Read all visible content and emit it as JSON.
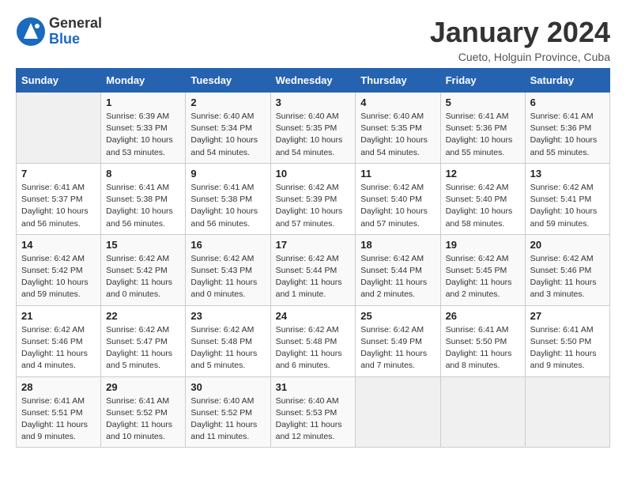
{
  "header": {
    "logo_line1": "General",
    "logo_line2": "Blue",
    "month": "January 2024",
    "location": "Cueto, Holguin Province, Cuba"
  },
  "weekdays": [
    "Sunday",
    "Monday",
    "Tuesday",
    "Wednesday",
    "Thursday",
    "Friday",
    "Saturday"
  ],
  "weeks": [
    [
      {
        "day": "",
        "info": ""
      },
      {
        "day": "1",
        "info": "Sunrise: 6:39 AM\nSunset: 5:33 PM\nDaylight: 10 hours\nand 53 minutes."
      },
      {
        "day": "2",
        "info": "Sunrise: 6:40 AM\nSunset: 5:34 PM\nDaylight: 10 hours\nand 54 minutes."
      },
      {
        "day": "3",
        "info": "Sunrise: 6:40 AM\nSunset: 5:35 PM\nDaylight: 10 hours\nand 54 minutes."
      },
      {
        "day": "4",
        "info": "Sunrise: 6:40 AM\nSunset: 5:35 PM\nDaylight: 10 hours\nand 54 minutes."
      },
      {
        "day": "5",
        "info": "Sunrise: 6:41 AM\nSunset: 5:36 PM\nDaylight: 10 hours\nand 55 minutes."
      },
      {
        "day": "6",
        "info": "Sunrise: 6:41 AM\nSunset: 5:36 PM\nDaylight: 10 hours\nand 55 minutes."
      }
    ],
    [
      {
        "day": "7",
        "info": "Sunrise: 6:41 AM\nSunset: 5:37 PM\nDaylight: 10 hours\nand 56 minutes."
      },
      {
        "day": "8",
        "info": "Sunrise: 6:41 AM\nSunset: 5:38 PM\nDaylight: 10 hours\nand 56 minutes."
      },
      {
        "day": "9",
        "info": "Sunrise: 6:41 AM\nSunset: 5:38 PM\nDaylight: 10 hours\nand 56 minutes."
      },
      {
        "day": "10",
        "info": "Sunrise: 6:42 AM\nSunset: 5:39 PM\nDaylight: 10 hours\nand 57 minutes."
      },
      {
        "day": "11",
        "info": "Sunrise: 6:42 AM\nSunset: 5:40 PM\nDaylight: 10 hours\nand 57 minutes."
      },
      {
        "day": "12",
        "info": "Sunrise: 6:42 AM\nSunset: 5:40 PM\nDaylight: 10 hours\nand 58 minutes."
      },
      {
        "day": "13",
        "info": "Sunrise: 6:42 AM\nSunset: 5:41 PM\nDaylight: 10 hours\nand 59 minutes."
      }
    ],
    [
      {
        "day": "14",
        "info": "Sunrise: 6:42 AM\nSunset: 5:42 PM\nDaylight: 10 hours\nand 59 minutes."
      },
      {
        "day": "15",
        "info": "Sunrise: 6:42 AM\nSunset: 5:42 PM\nDaylight: 11 hours\nand 0 minutes."
      },
      {
        "day": "16",
        "info": "Sunrise: 6:42 AM\nSunset: 5:43 PM\nDaylight: 11 hours\nand 0 minutes."
      },
      {
        "day": "17",
        "info": "Sunrise: 6:42 AM\nSunset: 5:44 PM\nDaylight: 11 hours\nand 1 minute."
      },
      {
        "day": "18",
        "info": "Sunrise: 6:42 AM\nSunset: 5:44 PM\nDaylight: 11 hours\nand 2 minutes."
      },
      {
        "day": "19",
        "info": "Sunrise: 6:42 AM\nSunset: 5:45 PM\nDaylight: 11 hours\nand 2 minutes."
      },
      {
        "day": "20",
        "info": "Sunrise: 6:42 AM\nSunset: 5:46 PM\nDaylight: 11 hours\nand 3 minutes."
      }
    ],
    [
      {
        "day": "21",
        "info": "Sunrise: 6:42 AM\nSunset: 5:46 PM\nDaylight: 11 hours\nand 4 minutes."
      },
      {
        "day": "22",
        "info": "Sunrise: 6:42 AM\nSunset: 5:47 PM\nDaylight: 11 hours\nand 5 minutes."
      },
      {
        "day": "23",
        "info": "Sunrise: 6:42 AM\nSunset: 5:48 PM\nDaylight: 11 hours\nand 5 minutes."
      },
      {
        "day": "24",
        "info": "Sunrise: 6:42 AM\nSunset: 5:48 PM\nDaylight: 11 hours\nand 6 minutes."
      },
      {
        "day": "25",
        "info": "Sunrise: 6:42 AM\nSunset: 5:49 PM\nDaylight: 11 hours\nand 7 minutes."
      },
      {
        "day": "26",
        "info": "Sunrise: 6:41 AM\nSunset: 5:50 PM\nDaylight: 11 hours\nand 8 minutes."
      },
      {
        "day": "27",
        "info": "Sunrise: 6:41 AM\nSunset: 5:50 PM\nDaylight: 11 hours\nand 9 minutes."
      }
    ],
    [
      {
        "day": "28",
        "info": "Sunrise: 6:41 AM\nSunset: 5:51 PM\nDaylight: 11 hours\nand 9 minutes."
      },
      {
        "day": "29",
        "info": "Sunrise: 6:41 AM\nSunset: 5:52 PM\nDaylight: 11 hours\nand 10 minutes."
      },
      {
        "day": "30",
        "info": "Sunrise: 6:40 AM\nSunset: 5:52 PM\nDaylight: 11 hours\nand 11 minutes."
      },
      {
        "day": "31",
        "info": "Sunrise: 6:40 AM\nSunset: 5:53 PM\nDaylight: 11 hours\nand 12 minutes."
      },
      {
        "day": "",
        "info": ""
      },
      {
        "day": "",
        "info": ""
      },
      {
        "day": "",
        "info": ""
      }
    ]
  ]
}
